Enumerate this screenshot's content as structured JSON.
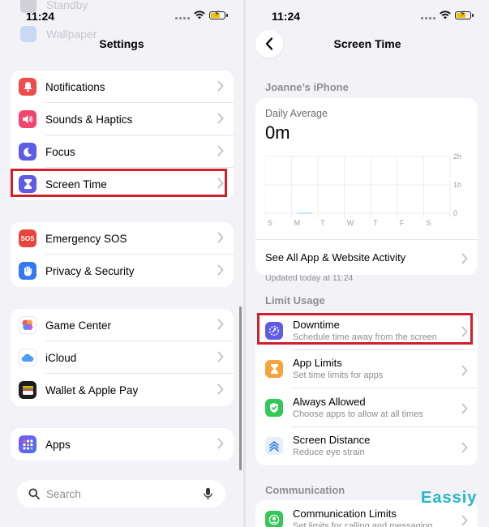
{
  "left": {
    "status": {
      "time": "11:24"
    },
    "ghost_rows": [
      "Standby",
      "Wallpaper"
    ],
    "title": "Settings",
    "groups": [
      {
        "items": [
          {
            "label": "Notifications",
            "icon": "bell-icon",
            "color": "#f14a4a"
          },
          {
            "label": "Sounds & Haptics",
            "icon": "speaker-icon",
            "color": "#f0466e"
          },
          {
            "label": "Focus",
            "icon": "moon-icon",
            "color": "#5e5ce6"
          },
          {
            "label": "Screen Time",
            "icon": "hourglass-icon",
            "color": "#5e5ce6"
          }
        ]
      },
      {
        "items": [
          {
            "label": "Emergency SOS",
            "icon": "sos-icon",
            "icon_text": "SOS",
            "color": "#e8453c"
          },
          {
            "label": "Privacy & Security",
            "icon": "hand-icon",
            "color": "#3478f6"
          }
        ]
      },
      {
        "items": [
          {
            "label": "Game Center",
            "icon": "game-center-icon",
            "color": "#ffffff"
          },
          {
            "label": "iCloud",
            "icon": "cloud-icon",
            "color": "#ffffff"
          },
          {
            "label": "Wallet & Apple Pay",
            "icon": "wallet-icon",
            "color": "#1c1c1e"
          }
        ]
      },
      {
        "items": [
          {
            "label": "Apps",
            "icon": "apps-grid-icon",
            "color": "#5e5ce6"
          }
        ]
      }
    ],
    "search": {
      "placeholder": "Search"
    }
  },
  "right": {
    "status": {
      "time": "11:24"
    },
    "title": "Screen Time",
    "device_header": "Joanne’s iPhone",
    "daily": {
      "label": "Daily Average",
      "value": "0m",
      "see_all": "See All App & Website Activity"
    },
    "chart_data": {
      "type": "bar",
      "categories": [
        "S",
        "M",
        "T",
        "W",
        "T",
        "F",
        "S"
      ],
      "values": [
        0,
        0,
        0,
        0,
        0,
        0,
        0
      ],
      "y_ticks": [
        "2h",
        "1h",
        "0"
      ],
      "ylim": [
        0,
        2
      ]
    },
    "updated": "Updated today at 11:24",
    "limit_header": "Limit Usage",
    "limit_items": [
      {
        "title": "Downtime",
        "subtitle": "Schedule time away from the screen",
        "icon": "downtime-icon",
        "color": "#5e5ce6"
      },
      {
        "title": "App Limits",
        "subtitle": "Set time limits for apps",
        "icon": "hourglass-icon",
        "color": "#f7a23b"
      },
      {
        "title": "Always Allowed",
        "subtitle": "Choose apps to allow at all times",
        "icon": "checkmark-shield-icon",
        "color": "#34c759"
      },
      {
        "title": "Screen Distance",
        "subtitle": "Reduce eye strain",
        "icon": "chevrons-up-icon",
        "color": "#e6effa"
      }
    ],
    "comm_header": "Communication",
    "comm_items": [
      {
        "title": "Communication Limits",
        "subtitle": "Set limits for calling and messaging",
        "icon": "person-circle-icon",
        "color": "#34c759"
      }
    ]
  },
  "watermark": "Eassiy"
}
